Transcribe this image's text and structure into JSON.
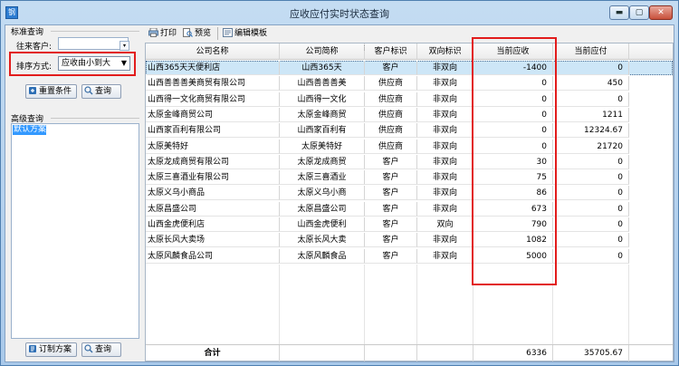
{
  "window": {
    "title": "应收应付实时状态查询",
    "app_icon_glyph": "钢",
    "min_glyph": "▬",
    "max_glyph": "▢",
    "close_glyph": "✕"
  },
  "left": {
    "standard_query_label": "标准查询",
    "customer_label": "往来客户:",
    "customer_value": "",
    "sort_label": "排序方式:",
    "sort_value": "应收由小到大",
    "reset_button": "重置条件",
    "query_button": "查询",
    "advanced_query_label": "高级查询",
    "plans": [
      "默认方案"
    ],
    "define_plan_button": "订制方案",
    "query_button_2": "查询"
  },
  "toolbar": {
    "print": "打印",
    "preview": "预览",
    "edit_template": "编辑模板"
  },
  "table": {
    "columns": [
      "公司名称",
      "公司简称",
      "客户标识",
      "双向标识",
      "当前应收",
      "当前应付"
    ],
    "rows": [
      {
        "name": "山西365天天便利店",
        "short": "山西365天",
        "type": "客户",
        "flag": "非双向",
        "receivable": "-1400",
        "payable": "0"
      },
      {
        "name": "山西善善善美商贸有限公司",
        "short": "山西善善善美",
        "type": "供应商",
        "flag": "非双向",
        "receivable": "0",
        "payable": "450"
      },
      {
        "name": "山西得一文化商贸有限公司",
        "short": "山西得一文化",
        "type": "供应商",
        "flag": "非双向",
        "receivable": "0",
        "payable": "0"
      },
      {
        "name": "太原金峰商贸公司",
        "short": "太原金峰商贸",
        "type": "供应商",
        "flag": "非双向",
        "receivable": "0",
        "payable": "1211"
      },
      {
        "name": "山西家百利有限公司",
        "short": "山西家百利有",
        "type": "供应商",
        "flag": "非双向",
        "receivable": "0",
        "payable": "12324.67"
      },
      {
        "name": "太原美特好",
        "short": "太原美特好",
        "type": "供应商",
        "flag": "非双向",
        "receivable": "0",
        "payable": "21720"
      },
      {
        "name": "太原龙成商贸有限公司",
        "short": "太原龙成商贸",
        "type": "客户",
        "flag": "非双向",
        "receivable": "30",
        "payable": "0"
      },
      {
        "name": "太原三喜酒业有限公司",
        "short": "太原三喜酒业",
        "type": "客户",
        "flag": "非双向",
        "receivable": "75",
        "payable": "0"
      },
      {
        "name": "太原义乌小商品",
        "short": "太原义乌小商",
        "type": "客户",
        "flag": "非双向",
        "receivable": "86",
        "payable": "0"
      },
      {
        "name": "太原昌盛公司",
        "short": "太原昌盛公司",
        "type": "客户",
        "flag": "非双向",
        "receivable": "673",
        "payable": "0"
      },
      {
        "name": "山西金虎便利店",
        "short": "山西金虎便利",
        "type": "客户",
        "flag": "双向",
        "receivable": "790",
        "payable": "0"
      },
      {
        "name": "太原长风大卖场",
        "short": "太原长风大卖",
        "type": "客户",
        "flag": "非双向",
        "receivable": "1082",
        "payable": "0"
      },
      {
        "name": "太原风麟食品公司",
        "short": "太原风麟食品",
        "type": "客户",
        "flag": "非双向",
        "receivable": "5000",
        "payable": "0"
      }
    ],
    "footer": {
      "label": "合计",
      "receivable_total": "6336",
      "payable_total": "35705.67"
    }
  },
  "colors": {
    "highlight_box": "#e21c1c",
    "selected_row": "#cde6f7",
    "list_selection": "#3399ff"
  }
}
